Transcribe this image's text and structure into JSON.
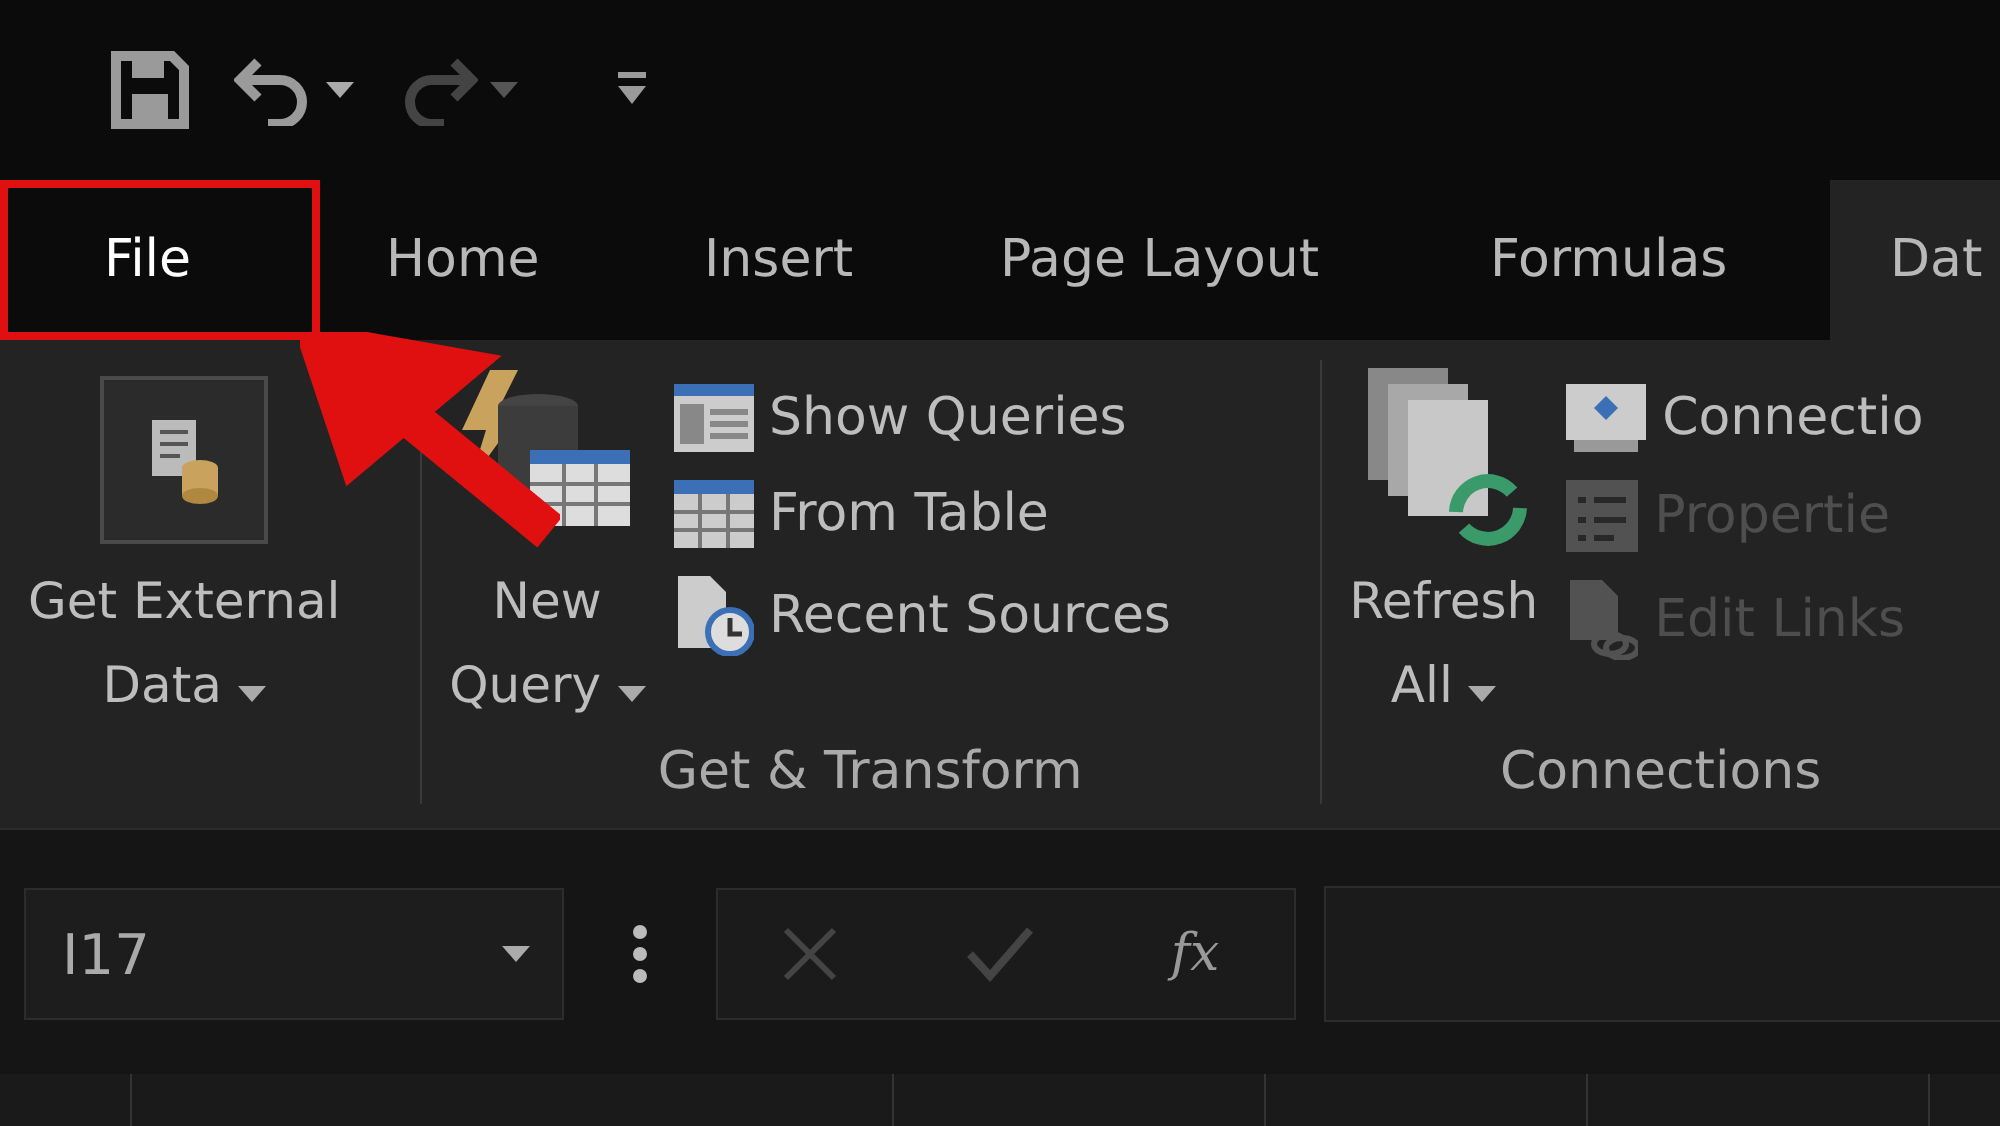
{
  "quick_access": [
    {
      "kind": "save"
    },
    {
      "kind": "undo"
    },
    {
      "kind": "redo",
      "disabled": true
    },
    {
      "kind": "customize"
    }
  ],
  "tabs": [
    {
      "label": "File",
      "selected": false,
      "highlighted": true
    },
    {
      "label": "Home",
      "selected": false,
      "highlighted": false
    },
    {
      "label": "Insert",
      "selected": false,
      "highlighted": false
    },
    {
      "label": "Page Layout",
      "selected": false,
      "highlighted": false
    },
    {
      "label": "Formulas",
      "selected": false,
      "highlighted": false
    },
    {
      "label": "Dat",
      "selected": true,
      "highlighted": false
    }
  ],
  "ribbon_groups": [
    {
      "big_button": {
        "kind": "external",
        "lines": [
          "Get External",
          "Data"
        ],
        "dropdown": true
      }
    },
    {
      "label": "Get & Transform",
      "big_button": {
        "kind": "query",
        "lines": [
          "New",
          "Query"
        ],
        "dropdown": true
      },
      "small_buttons": [
        {
          "kind": "show",
          "label": "Show Queries",
          "disabled": false
        },
        {
          "kind": "table",
          "label": "From Table",
          "disabled": false
        },
        {
          "kind": "recent",
          "label": "Recent Sources",
          "disabled": false
        }
      ]
    },
    {
      "label": "Connections",
      "big_button": {
        "kind": "refresh",
        "lines": [
          "Refresh",
          "All"
        ],
        "dropdown": true
      },
      "small_buttons": [
        {
          "kind": "connections",
          "label": "Connectio",
          "disabled": false
        },
        {
          "kind": "properties",
          "label": "Propertie",
          "disabled": true
        },
        {
          "kind": "links",
          "label": "Edit Links",
          "disabled": true
        }
      ]
    }
  ],
  "formula_bar": {
    "name_box": "I17",
    "fx": "fx"
  }
}
